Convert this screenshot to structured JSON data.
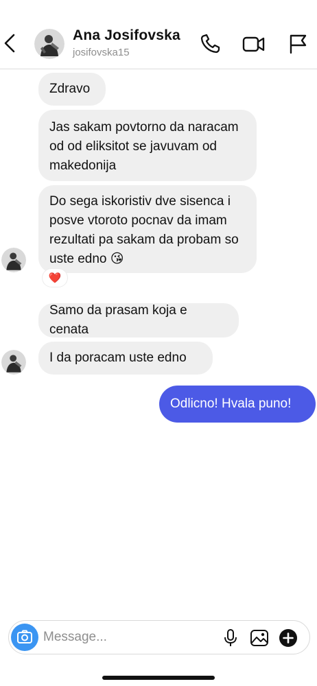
{
  "header": {
    "back_icon": "chevron-left-icon",
    "name": "Ana Josifovska",
    "username": "josifovska15",
    "icons": [
      "phone-icon",
      "video-camera-icon",
      "flag-icon"
    ]
  },
  "messages": [
    {
      "sender": "contact",
      "text": "Zdravo"
    },
    {
      "sender": "contact",
      "text": "Jas sakam povtorno da naracam od od eliksitot se javuvam od makedonija"
    },
    {
      "sender": "contact",
      "text": "Do sega iskoristiv dve sisenca i posve vtoroto pocnav da imam rezultati pa sakam da probam so uste edno 😘",
      "reaction": "❤️"
    },
    {
      "sender": "contact",
      "text": "Samo da prasam koja e cenata"
    },
    {
      "sender": "contact",
      "text": "I da poracam uste edno"
    },
    {
      "sender": "me",
      "text": "Odlicno! Hvala puno!"
    }
  ],
  "composer": {
    "camera_icon": "camera-icon",
    "placeholder": "Message...",
    "icons": [
      "microphone-icon",
      "gallery-icon",
      "plus-icon"
    ]
  },
  "colors": {
    "incoming_bubble": "#efefef",
    "outgoing_bubble": "#4c5ae6",
    "camera_button": "#3b95f2",
    "secondary_text": "#8e8e8e"
  }
}
